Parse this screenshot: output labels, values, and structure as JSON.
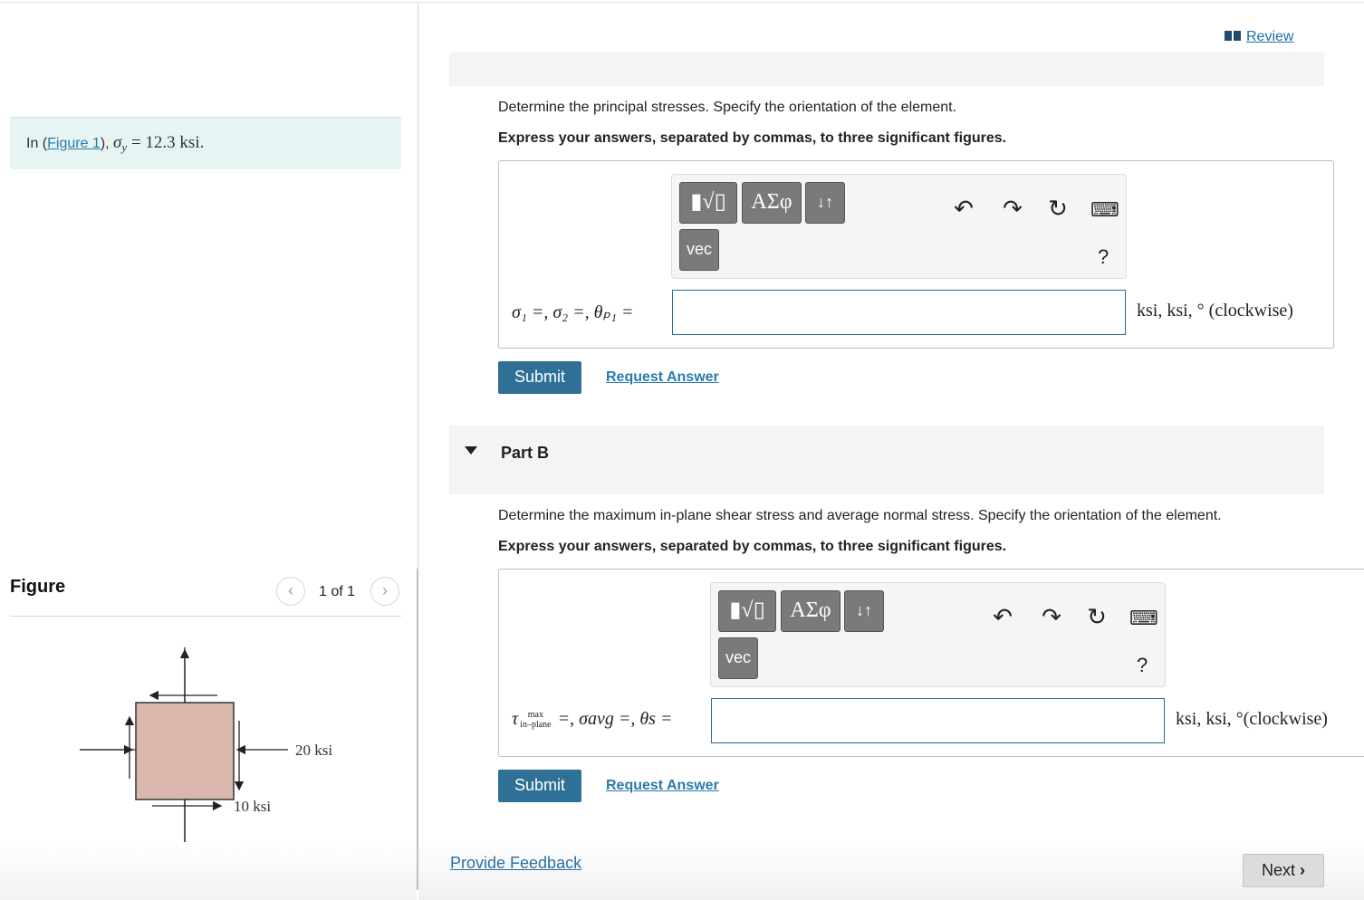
{
  "left": {
    "given_prefix": "In (",
    "figure_link": "Figure 1",
    "given_suffix": "), ",
    "given_math_var": "σ",
    "given_math_sub": "y",
    "given_math_rest": " = 12.3 ksi."
  },
  "figure": {
    "title": "Figure",
    "pager_text": "1 of 1",
    "label_20": "20 ksi",
    "label_10": "10 ksi",
    "element_fill": "#dbb6ad"
  },
  "header": {
    "review_label": "Review"
  },
  "partA": {
    "question": "Determine the principal stresses. Specify the orientation of the element.",
    "instruction": "Express your answers, separated by commas, to three significant figures.",
    "lhs": "σ₁ =, σ₂ =, θₚ₁ =",
    "units": "ksi,  ksi,  ° (clockwise)",
    "submit_label": "Submit",
    "request_label": "Request Answer"
  },
  "partB": {
    "title": "Part B",
    "question": "Determine the maximum in-plane shear stress and average normal stress. Specify the orientation of the element.",
    "instruction": "Express your answers, separated by commas, to three significant figures.",
    "tau": "τ",
    "tau_sup": "max",
    "tau_sub": "in–plane",
    "lhs_rest": " =, σavg =, θs =",
    "units": "ksi,  ksi,  °(clockwise)",
    "submit_label": "Submit",
    "request_label": "Request Answer"
  },
  "toolbar": {
    "templates_icon": "templates-icon",
    "greek_label": "ΑΣφ",
    "arrows_label": "↓↑",
    "vec_label": "vec",
    "help_label": "?"
  },
  "footer": {
    "feedback_label": "Provide Feedback",
    "next_label": "Next"
  },
  "colors": {
    "accent": "#2f7196",
    "given_bg": "#e6f4f3",
    "link": "#2a7bab"
  }
}
